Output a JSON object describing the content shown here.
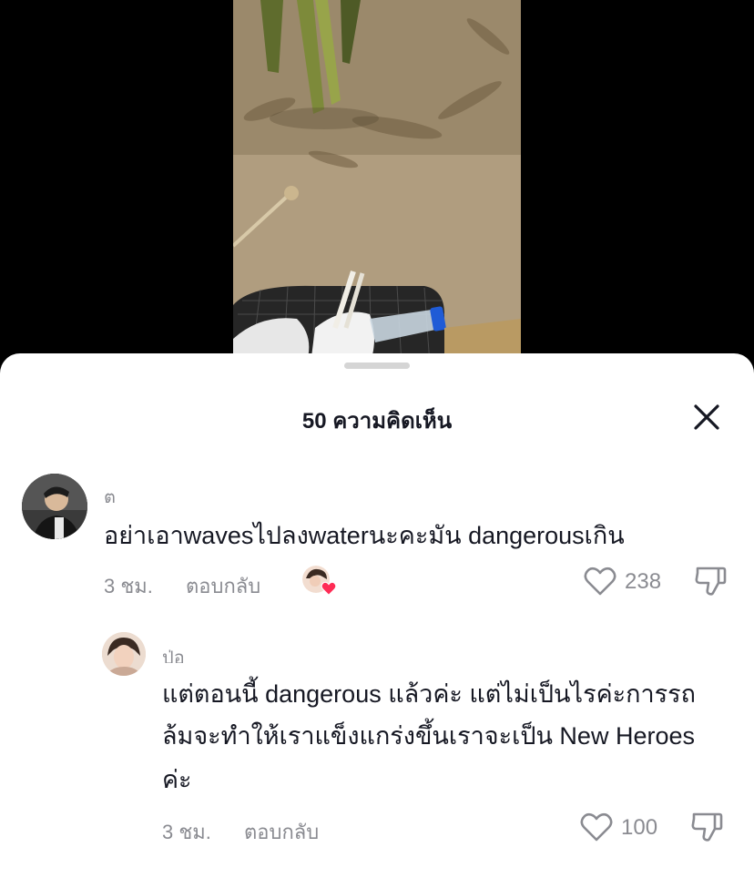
{
  "sheet": {
    "title": "50 ความคิดเห็น"
  },
  "comments": [
    {
      "username": "ต",
      "text": "อย่าเอาwavesไปลงwaterนะคะมัน dangerousเกิน",
      "time": "3 ชม.",
      "reply_label": "ตอบกลับ",
      "likes": "238",
      "creator_liked": true
    },
    {
      "username": "ป่อ",
      "text_lines": [
        "แต่ตอนนี้ dangerous แล้วค่ะ แต่ไม่เป็นไรค่ะการรถ",
        "ล้มจะทำให้เราแข็งแกร่งขึ้นเราจะเป็น New Heroes",
        "ค่ะ"
      ],
      "time": "3 ชม.",
      "reply_label": "ตอบกลับ",
      "likes": "100"
    }
  ],
  "icons": {
    "close": "close-icon",
    "like": "heart-outline-icon",
    "dislike": "thumbs-down-icon",
    "creator_like": "creator-liked-heart-icon"
  },
  "colors": {
    "text": "#161823",
    "muted": "#8a8b91",
    "accent": "#fe2c55"
  }
}
